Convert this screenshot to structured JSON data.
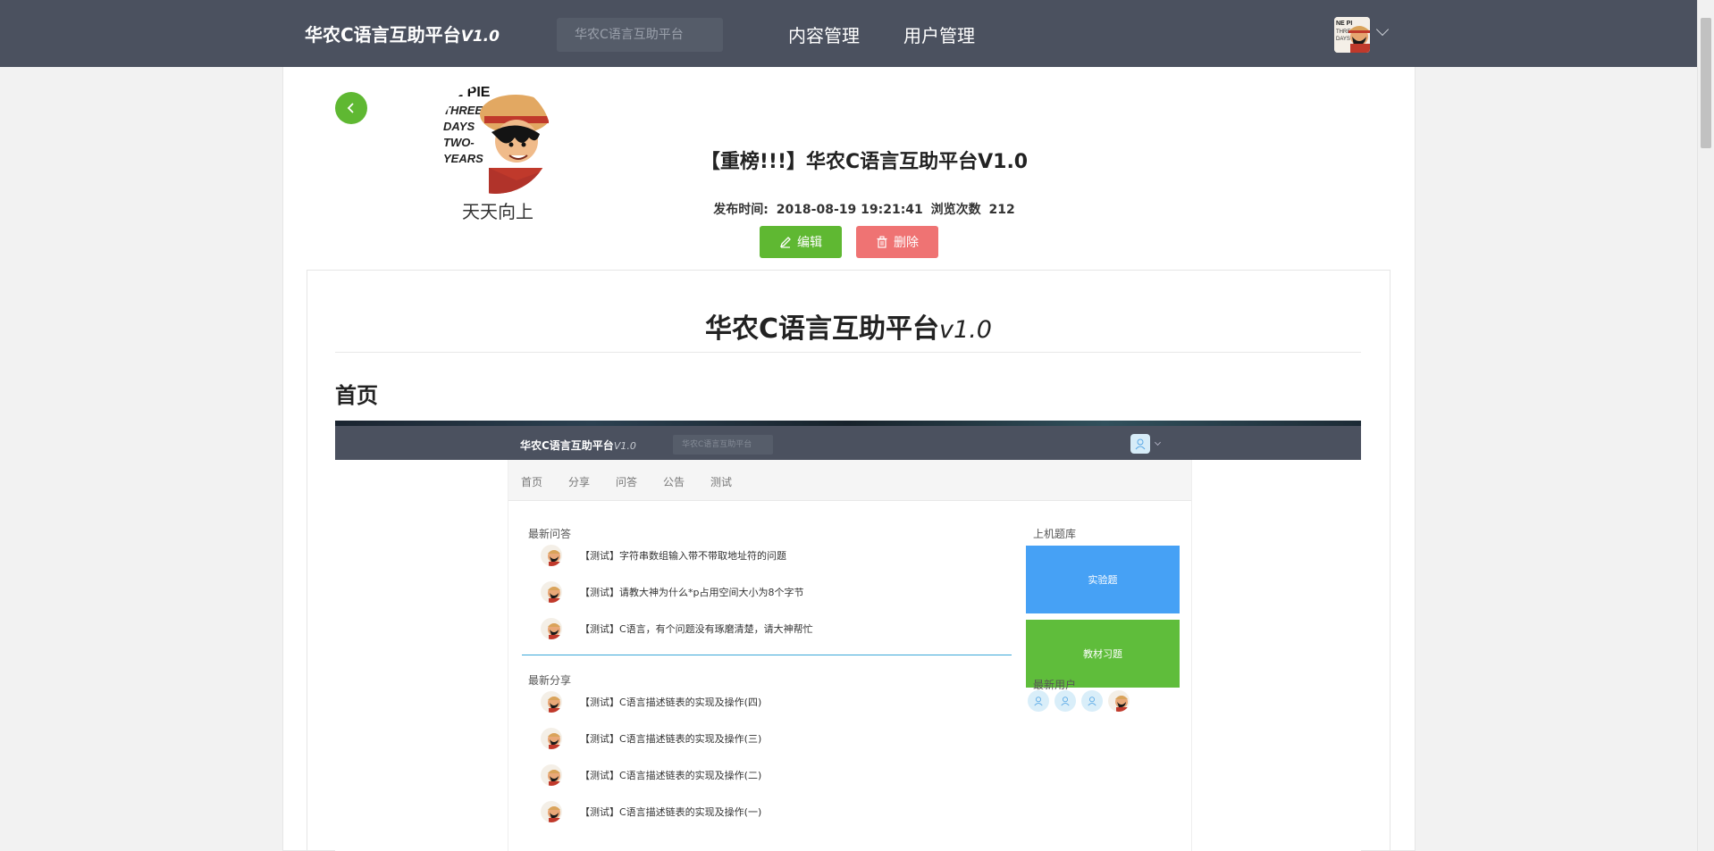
{
  "header": {
    "logo": "华农C语言互助平台",
    "logo_version": "V1.0",
    "search_placeholder": "华农C语言互助平台",
    "nav": [
      "内容管理",
      "用户管理"
    ]
  },
  "author": {
    "name": "天天向上"
  },
  "post": {
    "title": "【重榜!!!】华农C语言互助平台V1.0",
    "meta_label": "发布时间:",
    "publish_time": "2018-08-19 19:21:41",
    "views_label": "浏览次数",
    "views": "212",
    "edit_label": "编辑",
    "delete_label": "删除"
  },
  "content": {
    "heading": "华农C语言互助平台",
    "heading_version": "v1.0",
    "section": "首页"
  },
  "embedded": {
    "logo": "华农C语言互助平台",
    "logo_version": "V1.0",
    "search_placeholder": "华农C语言互助平台",
    "tabs": [
      "首页",
      "分享",
      "问答",
      "公告",
      "测试"
    ],
    "qa_title": "最新问答",
    "qa_items": [
      "【测试】字符串数组输入带不带取地址符的问题",
      "【测试】请教大神为什么*p占用空间大小为8个字节",
      "【测试】C语言，有个问题没有琢磨清楚，请大神帮忙"
    ],
    "share_title": "最新分享",
    "share_items": [
      "【测试】C语言描述链表的实现及操作(四)",
      "【测试】C语言描述链表的实现及操作(三)",
      "【测试】C语言描述链表的实现及操作(二)",
      "【测试】C语言描述链表的实现及操作(一)"
    ],
    "bank_title": "上机题库",
    "bank_tiles": [
      "实验题",
      "教材习题"
    ],
    "new_users_title": "最新用户"
  }
}
